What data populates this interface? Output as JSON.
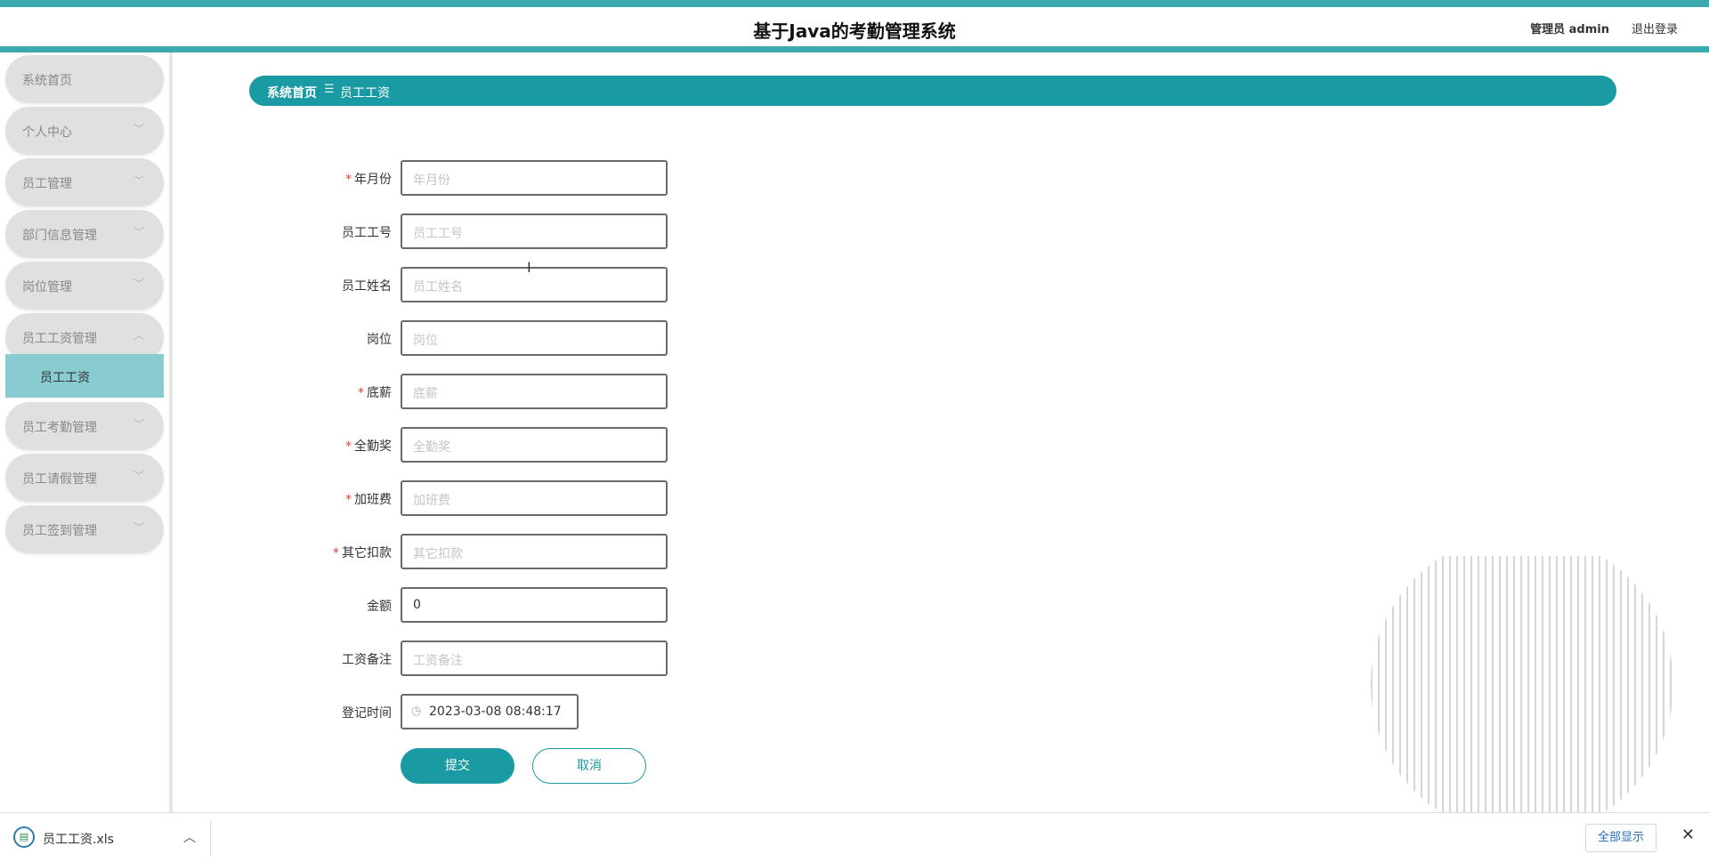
{
  "header": {
    "title": "基于Java的考勤管理系统",
    "user": "管理员 admin",
    "logout": "退出登录"
  },
  "sidebar": {
    "items": [
      {
        "label": "系统首页",
        "expandable": false
      },
      {
        "label": "个人中心",
        "expandable": true
      },
      {
        "label": "员工管理",
        "expandable": true
      },
      {
        "label": "部门信息管理",
        "expandable": true
      },
      {
        "label": "岗位管理",
        "expandable": true
      },
      {
        "label": "员工工资管理",
        "expandable": true,
        "expanded": true,
        "children": [
          {
            "label": "员工工资",
            "active": true
          }
        ]
      },
      {
        "label": "员工考勤管理",
        "expandable": true
      },
      {
        "label": "员工请假管理",
        "expandable": true
      },
      {
        "label": "员工签到管理",
        "expandable": true
      }
    ],
    "chevron_down": "﹀",
    "chevron_up": "︿"
  },
  "breadcrumb": {
    "home": "系统首页",
    "separator": "☰",
    "current": "员工工资"
  },
  "form": {
    "fields": [
      {
        "label": "年月份",
        "required": true,
        "placeholder": "年月份",
        "value": ""
      },
      {
        "label": "员工工号",
        "required": false,
        "placeholder": "员工工号",
        "value": ""
      },
      {
        "label": "员工姓名",
        "required": false,
        "placeholder": "员工姓名",
        "value": ""
      },
      {
        "label": "岗位",
        "required": false,
        "placeholder": "岗位",
        "value": ""
      },
      {
        "label": "底薪",
        "required": true,
        "placeholder": "底薪",
        "value": ""
      },
      {
        "label": "全勤奖",
        "required": true,
        "placeholder": "全勤奖",
        "value": ""
      },
      {
        "label": "加班费",
        "required": true,
        "placeholder": "加班费",
        "value": ""
      },
      {
        "label": "其它扣款",
        "required": true,
        "placeholder": "其它扣款",
        "value": ""
      },
      {
        "label": "金额",
        "required": false,
        "placeholder": "",
        "value": "0"
      },
      {
        "label": "工资备注",
        "required": false,
        "placeholder": "工资备注",
        "value": ""
      }
    ],
    "date_field": {
      "label": "登记时间",
      "value": "2023-03-08 08:48:17"
    },
    "required_mark": "*",
    "submit": "提交",
    "cancel": "取消"
  },
  "download_bar": {
    "file_name": "员工工资.xls",
    "show_all": "全部显示",
    "close": "✕",
    "chevron": "︿"
  },
  "colors": {
    "accent": "#1a9aa3",
    "header_stripe": "#3aa9b0",
    "active_submenu": "#88cbd1",
    "required": "#e0423d"
  }
}
